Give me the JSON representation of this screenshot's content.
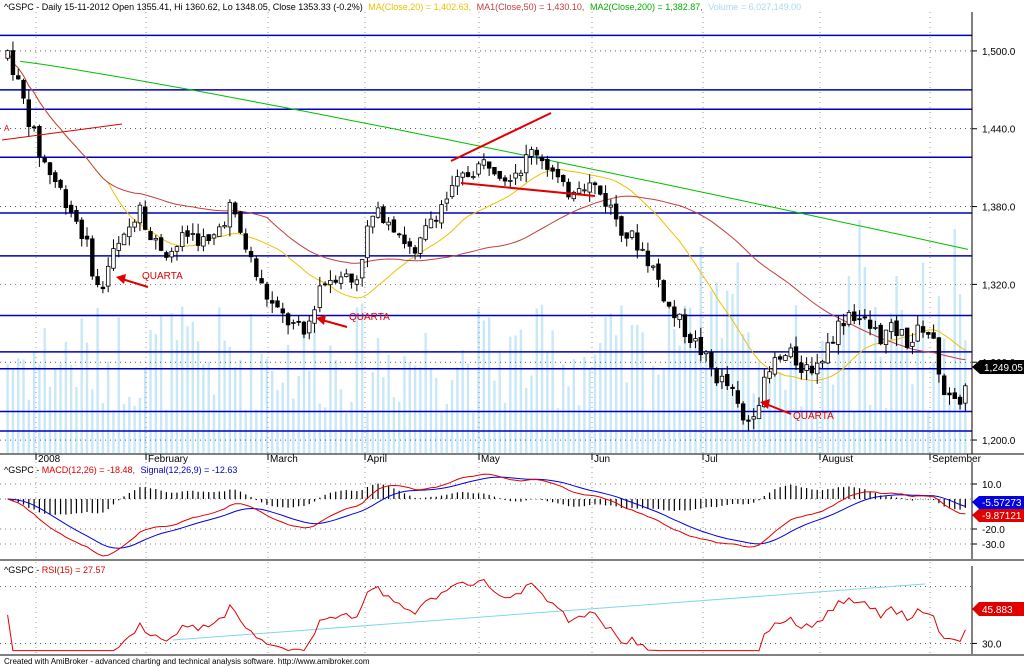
{
  "header": {
    "symbol": "^GSPC",
    "text_main": "^GSPC - Daily 15-11-2012 Open 1355.41, Hi 1360.62, Lo 1348.05, Close 1353.33 (-0.2%)",
    "ma20": "MA(Close,20) = 1,402.63,",
    "ma50": "MA1(Close,50) = 1,430.10,",
    "ma200": "MA2(Close,200) = 1,382.87,",
    "volume": "Volume = 6,027,149.00"
  },
  "macd_header": {
    "prefix": "^GSPC - ",
    "macd": "MACD(12,26) = -18.48,",
    "signal": "Signal(12,26,9) = -12.63"
  },
  "rsi_header": {
    "prefix": "^GSPC - ",
    "rsi": "RSI(15) = 27.57"
  },
  "footer": "Created with AmiBroker - advanced charting and technical analysis software. http://www.amibroker.com",
  "last_price_label": "1,249.05",
  "macd_label": "-5.57273",
  "signal_label": "-9.87121",
  "rsi_label": "45.883",
  "annotations": [
    "QUARTA",
    "QUARTA",
    "QUARTA"
  ],
  "marker_a": "A",
  "colors": {
    "ma20": "#f0c000",
    "ma50": "#c04040",
    "ma200": "#00c000",
    "volume": "#c8e8f8",
    "macd": "#e00000",
    "signal": "#0000e0",
    "rsi": "#e00000",
    "hline": "#0000c0",
    "annot": "#e00000"
  },
  "chart_data": [
    {
      "type": "candlestick",
      "title": "^GSPC - Daily",
      "x_ticks": [
        "2008",
        "February",
        "March",
        "April",
        "May",
        "Jun",
        "Jul",
        "August",
        "September"
      ],
      "y_ticks": [
        "1,500.0",
        "1,440.0",
        "1,380.0",
        "1,320.0",
        "1,260.0",
        "1,200.0"
      ],
      "ylim": [
        1190,
        1530
      ],
      "horizontal_levels": [
        1512,
        1470,
        1455,
        1418,
        1375,
        1342,
        1296,
        1268,
        1255,
        1222,
        1207
      ],
      "series": [
        {
          "name": "MA(Close,20)",
          "last": 1402.63
        },
        {
          "name": "MA1(Close,50)",
          "last": 1430.1
        },
        {
          "name": "MA2(Close,200)",
          "last": 1382.87
        },
        {
          "name": "Volume",
          "last": 6027149
        }
      ],
      "last_close": 1249.05
    },
    {
      "type": "line",
      "title": "MACD(12,26)",
      "y_ticks": [
        "10.0",
        "-20.0",
        "-30.0"
      ],
      "ylim": [
        -38,
        18
      ],
      "series": [
        {
          "name": "MACD(12,26)",
          "last": -18.48
        },
        {
          "name": "Signal(12,26,9)",
          "last": -12.63
        }
      ]
    },
    {
      "type": "line",
      "title": "RSI(15)",
      "y_ticks": [
        "30.0"
      ],
      "ylim": [
        24,
        78
      ],
      "series": [
        {
          "name": "RSI(15)",
          "last": 27.57
        }
      ]
    }
  ]
}
